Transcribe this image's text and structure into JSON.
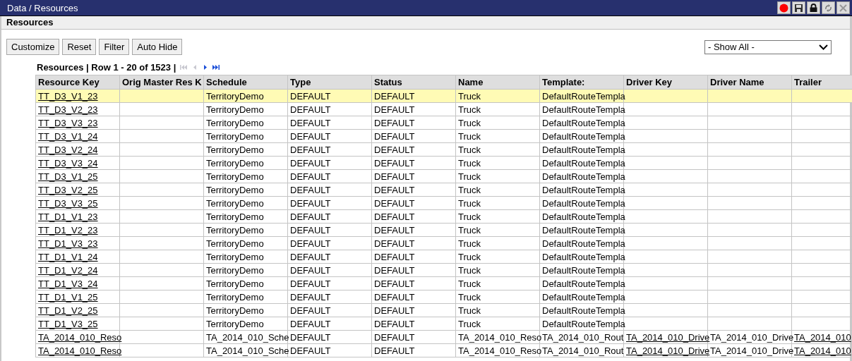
{
  "window": {
    "title": "Data / Resources"
  },
  "section": {
    "title": "Resources"
  },
  "toolbar": {
    "buttons": [
      "Customize",
      "Reset",
      "Filter",
      "Auto Hide"
    ],
    "dropdown": {
      "value": "- Show All -"
    }
  },
  "pager": {
    "text": "Resources | Row 1 - 20 of 1523 |",
    "first_disabled": true,
    "prev_disabled": true,
    "next_disabled": false,
    "last_disabled": false
  },
  "table": {
    "columns": [
      {
        "label": "Resource Key",
        "kind": "link"
      },
      {
        "label": "Orig Master Res K"
      },
      {
        "label": "Schedule",
        "kind": "text"
      },
      {
        "label": "Type",
        "kind": "text"
      },
      {
        "label": "Status",
        "kind": "text"
      },
      {
        "label": "Name",
        "kind": "text"
      },
      {
        "label": "Template:",
        "kind": "text"
      },
      {
        "label": "Driver Key",
        "kind": "link"
      },
      {
        "label": "Driver Name",
        "kind": "text"
      },
      {
        "label": "Trailer",
        "kind": "link"
      }
    ],
    "rows": [
      {
        "selected": true,
        "cells": [
          "TT_D3_V1_23",
          null,
          "TerritoryDemo",
          "DEFAULT",
          "DEFAULT",
          "Truck",
          "DefaultRouteTempla",
          null,
          null,
          null
        ]
      },
      {
        "selected": false,
        "cells": [
          "TT_D3_V2_23",
          null,
          "TerritoryDemo",
          "DEFAULT",
          "DEFAULT",
          "Truck",
          "DefaultRouteTempla",
          null,
          null,
          null
        ]
      },
      {
        "selected": false,
        "cells": [
          "TT_D3_V3_23",
          null,
          "TerritoryDemo",
          "DEFAULT",
          "DEFAULT",
          "Truck",
          "DefaultRouteTempla",
          null,
          null,
          null
        ]
      },
      {
        "selected": false,
        "cells": [
          "TT_D3_V1_24",
          null,
          "TerritoryDemo",
          "DEFAULT",
          "DEFAULT",
          "Truck",
          "DefaultRouteTempla",
          null,
          null,
          null
        ]
      },
      {
        "selected": false,
        "cells": [
          "TT_D3_V2_24",
          null,
          "TerritoryDemo",
          "DEFAULT",
          "DEFAULT",
          "Truck",
          "DefaultRouteTempla",
          null,
          null,
          null
        ]
      },
      {
        "selected": false,
        "cells": [
          "TT_D3_V3_24",
          null,
          "TerritoryDemo",
          "DEFAULT",
          "DEFAULT",
          "Truck",
          "DefaultRouteTempla",
          null,
          null,
          null
        ]
      },
      {
        "selected": false,
        "cells": [
          "TT_D3_V1_25",
          null,
          "TerritoryDemo",
          "DEFAULT",
          "DEFAULT",
          "Truck",
          "DefaultRouteTempla",
          null,
          null,
          null
        ]
      },
      {
        "selected": false,
        "cells": [
          "TT_D3_V2_25",
          null,
          "TerritoryDemo",
          "DEFAULT",
          "DEFAULT",
          "Truck",
          "DefaultRouteTempla",
          null,
          null,
          null
        ]
      },
      {
        "selected": false,
        "cells": [
          "TT_D3_V3_25",
          null,
          "TerritoryDemo",
          "DEFAULT",
          "DEFAULT",
          "Truck",
          "DefaultRouteTempla",
          null,
          null,
          null
        ]
      },
      {
        "selected": false,
        "cells": [
          "TT_D1_V1_23",
          null,
          "TerritoryDemo",
          "DEFAULT",
          "DEFAULT",
          "Truck",
          "DefaultRouteTempla",
          null,
          null,
          null
        ]
      },
      {
        "selected": false,
        "cells": [
          "TT_D1_V2_23",
          null,
          "TerritoryDemo",
          "DEFAULT",
          "DEFAULT",
          "Truck",
          "DefaultRouteTempla",
          null,
          null,
          null
        ]
      },
      {
        "selected": false,
        "cells": [
          "TT_D1_V3_23",
          null,
          "TerritoryDemo",
          "DEFAULT",
          "DEFAULT",
          "Truck",
          "DefaultRouteTempla",
          null,
          null,
          null
        ]
      },
      {
        "selected": false,
        "cells": [
          "TT_D1_V1_24",
          null,
          "TerritoryDemo",
          "DEFAULT",
          "DEFAULT",
          "Truck",
          "DefaultRouteTempla",
          null,
          null,
          null
        ]
      },
      {
        "selected": false,
        "cells": [
          "TT_D1_V2_24",
          null,
          "TerritoryDemo",
          "DEFAULT",
          "DEFAULT",
          "Truck",
          "DefaultRouteTempla",
          null,
          null,
          null
        ]
      },
      {
        "selected": false,
        "cells": [
          "TT_D1_V3_24",
          null,
          "TerritoryDemo",
          "DEFAULT",
          "DEFAULT",
          "Truck",
          "DefaultRouteTempla",
          null,
          null,
          null
        ]
      },
      {
        "selected": false,
        "cells": [
          "TT_D1_V1_25",
          null,
          "TerritoryDemo",
          "DEFAULT",
          "DEFAULT",
          "Truck",
          "DefaultRouteTempla",
          null,
          null,
          null
        ]
      },
      {
        "selected": false,
        "cells": [
          "TT_D1_V2_25",
          null,
          "TerritoryDemo",
          "DEFAULT",
          "DEFAULT",
          "Truck",
          "DefaultRouteTempla",
          null,
          null,
          null
        ]
      },
      {
        "selected": false,
        "cells": [
          "TT_D1_V3_25",
          null,
          "TerritoryDemo",
          "DEFAULT",
          "DEFAULT",
          "Truck",
          "DefaultRouteTempla",
          null,
          null,
          null
        ]
      },
      {
        "selected": false,
        "cells": [
          "TA_2014_010_Reso",
          null,
          "TA_2014_010_Sche",
          "DEFAULT",
          "DEFAULT",
          "TA_2014_010_Reso",
          "TA_2014_010_Rout",
          "TA_2014_010_Drive",
          "TA_2014_010_Drive",
          "TA_2014_010"
        ]
      },
      {
        "selected": false,
        "cells": [
          "TA_2014_010_Reso",
          null,
          "TA_2014_010_Sche",
          "DEFAULT",
          "DEFAULT",
          "TA_2014_010_Reso",
          "TA_2014_010_Rout",
          "TA_2014_010_Drive",
          "TA_2014_010_Drive",
          "TA_2014_010"
        ]
      }
    ]
  }
}
